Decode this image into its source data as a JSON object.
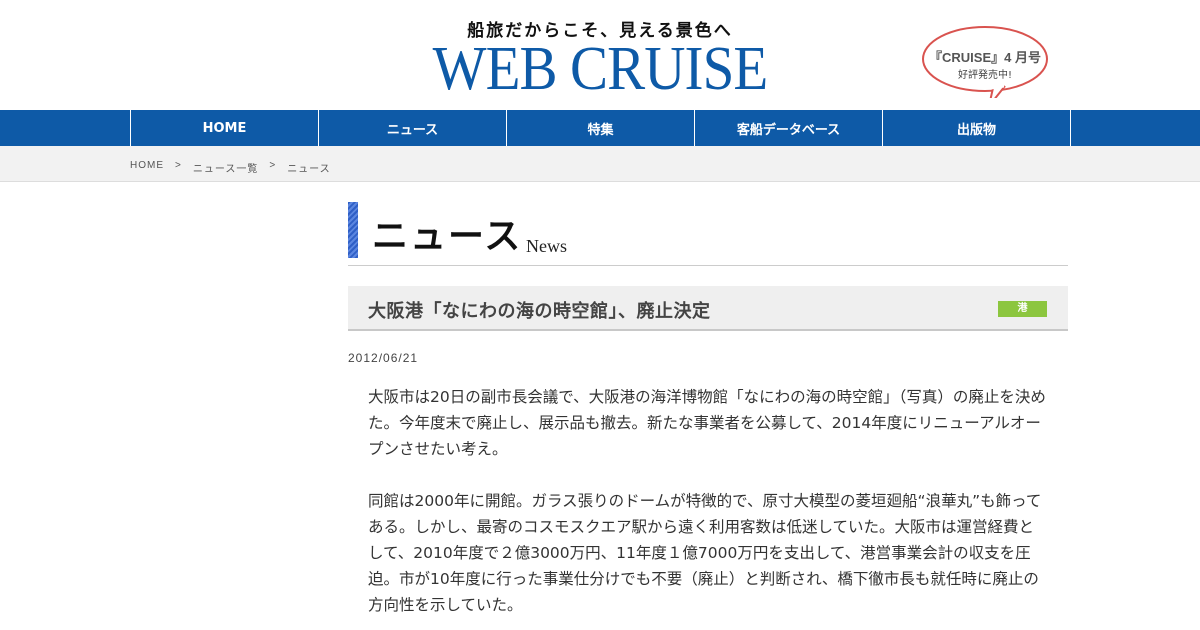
{
  "header": {
    "tagline": "船旅だからこそ、見える景色へ",
    "logo": "WEB CRUISE",
    "promo_line1": "『CRUISE』4 月号",
    "promo_line2": "好評発売中!",
    "promo_color": "#d9534f"
  },
  "nav": {
    "items": [
      {
        "label": "HOME"
      },
      {
        "label": "ニュース"
      },
      {
        "label": "特集"
      },
      {
        "label": "客船データベース"
      },
      {
        "label": "出版物"
      }
    ],
    "color": "#0e5aa7"
  },
  "breadcrumb": {
    "items": [
      {
        "label": "HOME"
      },
      {
        "label": "ニュース一覧"
      },
      {
        "label": "ニュース"
      }
    ],
    "separator": ">"
  },
  "section": {
    "title": "ニュース",
    "subtitle": "News"
  },
  "article": {
    "title": "大阪港「なにわの海の時空館」、廃止決定",
    "tag": "港",
    "tag_color": "#8cc63f",
    "date": "2012/06/21",
    "paragraphs": [
      "大阪市は20日の副市長会議で、大阪港の海洋博物館「なにわの海の時空館」（写真）の廃止を決めた。今年度末で廃止し、展示品も撤去。新たな事業者を公募して、2014年度にリニューアルオープンさせたい考え。",
      "同館は2000年に開館。ガラス張りのドームが特徴的で、原寸大模型の菱垣廻船“浪華丸”も飾ってある。しかし、最寄のコスモスクエア駅から遠く利用客数は低迷していた。大阪市は運営経費として、2010年度で２億3000万円、11年度１億7000万円を支出して、港営事業会計の収支を圧迫。市が10年度に行った事業仕分けでも不要（廃止）と判断され、橋下徹市長も就任時に廃止の方向性を示していた。"
    ]
  }
}
